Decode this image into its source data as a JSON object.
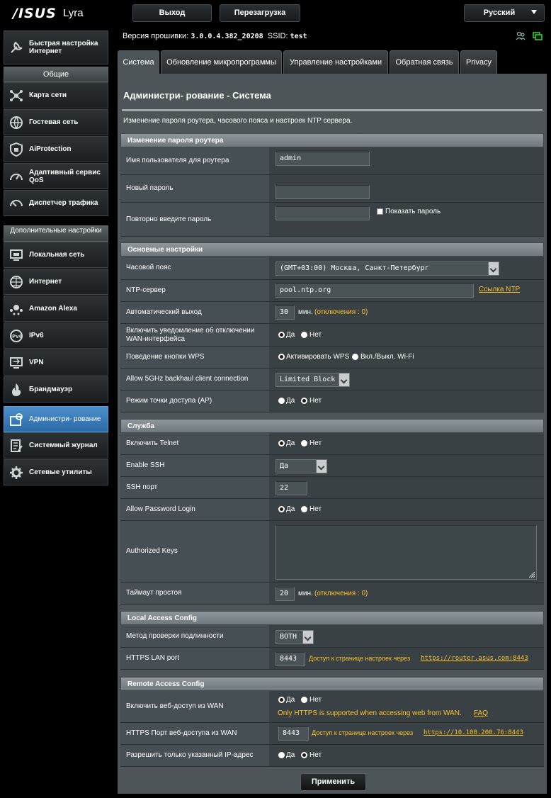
{
  "header": {
    "logo": "/ISUS",
    "model": "Lyra",
    "logout": "Выход",
    "reboot": "Перезагрузка",
    "language": "Русский"
  },
  "sidebar": {
    "quick_setup": "Быстрая настройка Интернет",
    "general_header": "Общие",
    "general": [
      {
        "label": "Карта сети",
        "icon": "network-map-icon"
      },
      {
        "label": "Гостевая сеть",
        "icon": "guest-network-icon"
      },
      {
        "label": "AiProtection",
        "icon": "shield-icon"
      },
      {
        "label": "Адаптивный сервис QoS",
        "icon": "gauge-icon"
      },
      {
        "label": "Диспетчер трафика",
        "icon": "traffic-icon"
      }
    ],
    "advanced_header": "Дополнительные настройки",
    "advanced": [
      {
        "label": "Локальная сеть",
        "icon": "lan-icon"
      },
      {
        "label": "Интернет",
        "icon": "globe-icon"
      },
      {
        "label": "Amazon Alexa",
        "icon": "alexa-icon"
      },
      {
        "label": "IPv6",
        "icon": "ipv6-icon"
      },
      {
        "label": "VPN",
        "icon": "vpn-icon"
      },
      {
        "label": "Брандмауэр",
        "icon": "firewall-icon"
      },
      {
        "label": "Администри- рование",
        "icon": "admin-gear-icon"
      },
      {
        "label": "Системный журнал",
        "icon": "log-icon"
      },
      {
        "label": "Сетевые утилиты",
        "icon": "tools-icon"
      }
    ]
  },
  "status": {
    "fw_label": "Версия прошивки:",
    "fw_value": "3.0.0.4.382_20208",
    "ssid_label": "SSID:",
    "ssid_value": "test"
  },
  "tabs": [
    "Система",
    "Обновление микропрограммы",
    "Управление настройками",
    "Обратная связь",
    "Privacy"
  ],
  "page": {
    "title": "Администри- рование - Система",
    "description": "Изменение пароля роутера, часового пояса и настроек NTP сервера."
  },
  "password_section": {
    "header": "Изменение пароля роутера",
    "username_label": "Имя пользователя для роутера",
    "username_value": "admin",
    "new_password_label": "Новый пароль",
    "repeat_password_label": "Повторно введите пароль",
    "show_password": "Показать пароль"
  },
  "basic_section": {
    "header": "Основные настройки",
    "timezone_label": "Часовой пояс",
    "timezone_value": "(GMT+03:00) Москва, Санкт-Петербург",
    "ntp_label": "NTP-сервер",
    "ntp_value": "pool.ntp.org",
    "ntp_link": "Ссылка NTP",
    "autologout_label": "Автоматический выход",
    "autologout_value": "30",
    "autologout_unit": "мин.",
    "autologout_hint": "(отключения : 0)",
    "wan_notify_label": "Включить уведомление об отключении WAN-интерфейса",
    "yes": "Да",
    "no": "Нет",
    "wps_label": "Поведение кнопки WPS",
    "wps_opt1": "Активировать WPS",
    "wps_opt2": "Вкл./Выкл. Wi-Fi",
    "backhaul_label": "Allow 5GHz backhaul client connection",
    "backhaul_value": "Limited Block",
    "ap_mode_label": "Режим точки доступа (AP)"
  },
  "service_section": {
    "header": "Служба",
    "telnet_label": "Включить Telnet",
    "ssh_label": "Enable SSH",
    "ssh_value": "Да",
    "ssh_port_label": "SSH порт",
    "ssh_port_value": "22",
    "pwd_login_label": "Allow Password Login",
    "auth_keys_label": "Authorized Keys",
    "idle_label": "Таймаут простоя",
    "idle_value": "20",
    "idle_unit": "мин.",
    "idle_hint": "(отключения : 0)"
  },
  "local_section": {
    "header": "Local Access Config",
    "auth_label": "Метод проверки подлинности",
    "auth_value": "BOTH",
    "https_port_label": "HTTPS LAN port",
    "https_port_value": "8443",
    "https_hint": "Доступ к странице настроек через",
    "https_link": "https://router.asus.com:8443"
  },
  "remote_section": {
    "header": "Remote Access Config",
    "wan_access_label": "Включить веб-доступ из WAN",
    "wan_note": "Only HTTPS is supported when accessing web from WAN.",
    "faq": "FAQ",
    "wan_port_label": "HTTPS Порт веб-доступа из WAN",
    "wan_port_value": "8443",
    "wan_hint": "Доступ к странице настроек через",
    "wan_link": "https://10.100.200.76:8443",
    "ip_only_label": "Разрешить только указанный IP-адрес"
  },
  "apply": "Применить"
}
